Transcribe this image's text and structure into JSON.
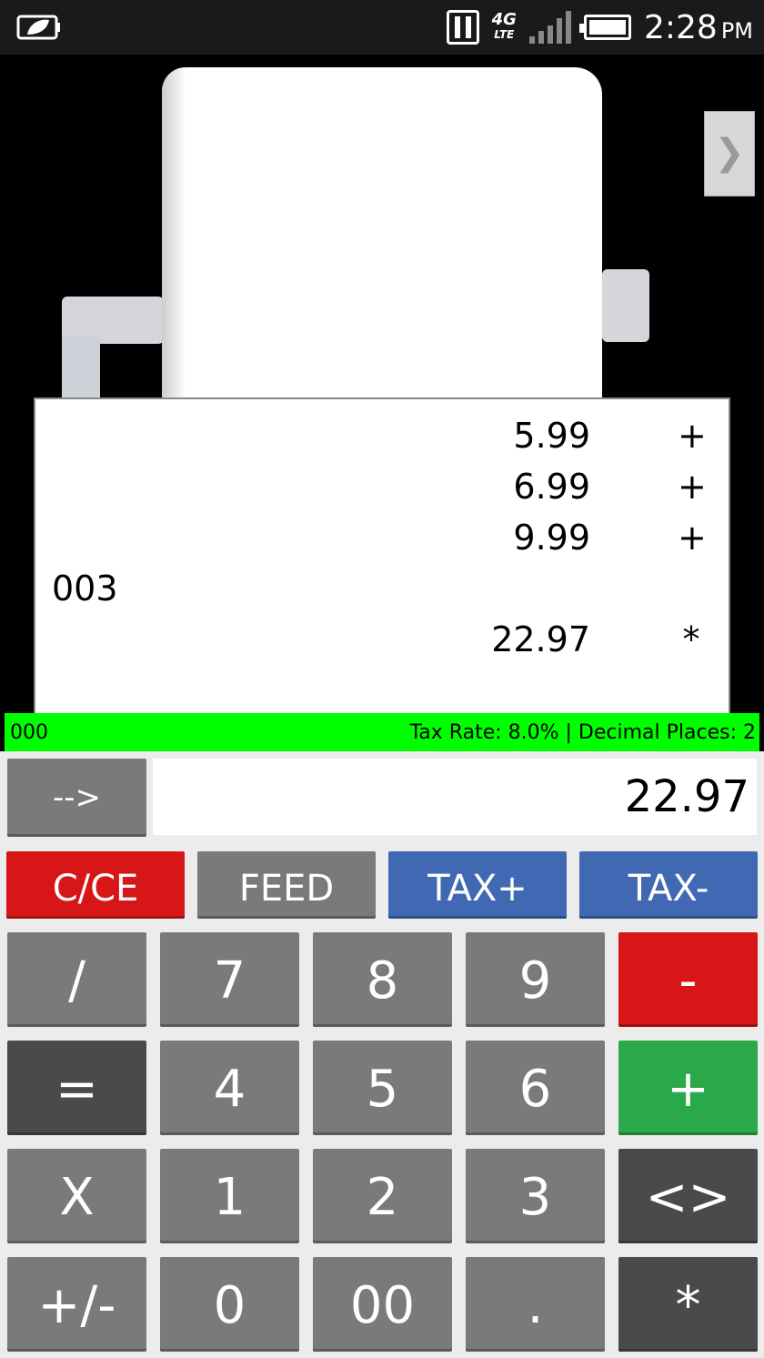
{
  "status_bar": {
    "time": "2:28",
    "ampm": "PM",
    "network": "4G",
    "network_sub": "LTE",
    "icons": [
      "battery-saver-icon",
      "nfc-icon",
      "lte-icon",
      "signal-icon",
      "battery-icon"
    ]
  },
  "roll": {
    "side_button_glyph": "❯"
  },
  "tape": {
    "rows": [
      {
        "value": "5.99",
        "op": "+"
      },
      {
        "value": "6.99",
        "op": "+"
      },
      {
        "value": "9.99",
        "op": "+"
      },
      {
        "label": "003"
      },
      {
        "value": "22.97",
        "op": "*"
      }
    ]
  },
  "info_bar": {
    "count": "000",
    "settings": "Tax Rate: 8.0% | Decimal Places: 2"
  },
  "display": {
    "arrow_label": "-->",
    "value": "22.97"
  },
  "function_keys": {
    "clear": "C/CE",
    "feed": "FEED",
    "tax_plus": "TAX+",
    "tax_minus": "TAX-"
  },
  "keys": {
    "divide": "/",
    "seven": "7",
    "eight": "8",
    "nine": "9",
    "minus": "-",
    "equals": "=",
    "four": "4",
    "five": "5",
    "six": "6",
    "plus": "+",
    "multiply": "X",
    "one": "1",
    "two": "2",
    "three": "3",
    "swap": "<>",
    "sign": "+/-",
    "zero": "0",
    "double_zero": "00",
    "decimal": ".",
    "total": "*"
  },
  "colors": {
    "red": "#d71618",
    "gray": "#7a7a7a",
    "blue": "#4169b3",
    "green": "#2aa84a",
    "dark": "#4a4a4a",
    "info_bar": "#00ff00"
  }
}
